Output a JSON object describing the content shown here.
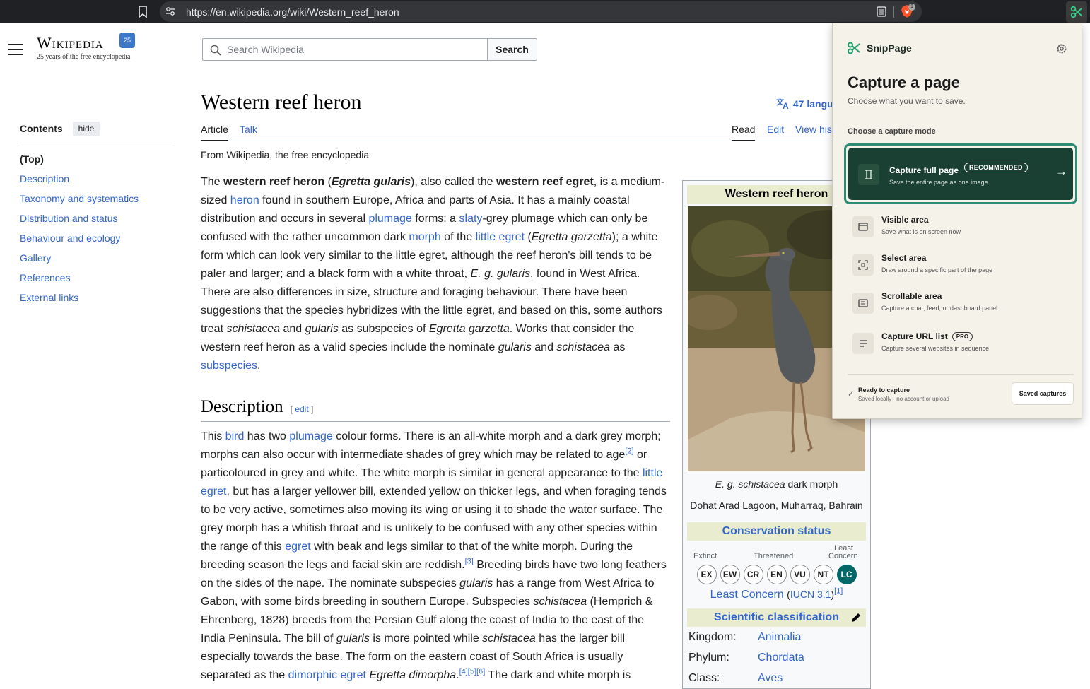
{
  "browser": {
    "url": "https://en.wikipedia.org/wiki/Western_reef_heron",
    "brave_badge": "1"
  },
  "wiki": {
    "logo_title": "Wikipedia",
    "logo_badge": "25",
    "tagline": "25 years of the free encyclopedia",
    "search_placeholder": "Search Wikipedia",
    "search_button": "Search",
    "page_title": "Western reef heron",
    "languages": "47 langu",
    "tabs": {
      "article": "Article",
      "talk": "Talk",
      "read": "Read",
      "edit": "Edit",
      "history": "View his"
    },
    "from": "From Wikipedia, the free encyclopedia",
    "toc": {
      "title": "Contents",
      "hide": "hide",
      "items": [
        "(Top)",
        "Description",
        "Taxonomy and systematics",
        "Distribution and status",
        "Behaviour and ecology",
        "Gallery",
        "References",
        "External links"
      ]
    },
    "lead": [
      {
        "t": "The "
      },
      {
        "t": "western reef heron",
        "b": true
      },
      {
        "t": " ("
      },
      {
        "t": "Egretta gularis",
        "b": true,
        "i": true
      },
      {
        "t": "), also called the "
      },
      {
        "t": "western reef egret",
        "b": true
      },
      {
        "t": ", is a medium-sized "
      },
      {
        "t": "heron",
        "a": true
      },
      {
        "t": " found in southern Europe, Africa and parts of Asia. It has a mainly coastal distribution and occurs in several "
      },
      {
        "t": "plumage",
        "a": true
      },
      {
        "t": " forms: a "
      },
      {
        "t": "slaty",
        "a": true
      },
      {
        "t": "-grey plumage which can only be confused with the rather uncommon dark "
      },
      {
        "t": "morph",
        "a": true
      },
      {
        "t": " of the "
      },
      {
        "t": "little egret",
        "a": true
      },
      {
        "t": " ("
      },
      {
        "t": "Egretta garzetta",
        "i": true
      },
      {
        "t": "); a white form which can look very similar to the little egret, although the reef heron's bill tends to be paler and larger; and a black form with a white throat, "
      },
      {
        "t": "E. g. gularis",
        "i": true
      },
      {
        "t": ", found in West Africa. There are also differences in size, structure and foraging behaviour. There have been suggestions that the species hybridizes with the little egret, and based on this, some authors treat "
      },
      {
        "t": "schistacea",
        "i": true
      },
      {
        "t": " and "
      },
      {
        "t": "gularis",
        "i": true
      },
      {
        "t": " as subspecies of "
      },
      {
        "t": "Egretta garzetta",
        "i": true
      },
      {
        "t": ". Works that consider the western reef heron as a valid species include the nominate "
      },
      {
        "t": "gularis",
        "i": true
      },
      {
        "t": " and "
      },
      {
        "t": "schistacea",
        "i": true
      },
      {
        "t": " as "
      },
      {
        "t": "subspecies",
        "a": true
      },
      {
        "t": "."
      }
    ],
    "desc_heading": "Description",
    "desc_edit": "edit",
    "desc_para": [
      {
        "t": "This "
      },
      {
        "t": "bird",
        "a": true
      },
      {
        "t": " has two "
      },
      {
        "t": "plumage",
        "a": true
      },
      {
        "t": " colour forms. There is an all-white morph and a dark grey morph; morphs can also occur with intermediate shades of grey which may be related to age"
      },
      {
        "t": "[2]",
        "sup": true
      },
      {
        "t": " or particoloured in grey and white. The white morph is similar in general appearance to the "
      },
      {
        "t": "little egret",
        "a": true
      },
      {
        "t": ", but has a larger yellower bill, extended yellow on thicker legs, and when foraging tends to be very active, sometimes also moving its wing or using it to shade the water surface. The grey morph has a whitish throat and is unlikely to be confused with any other species within the range of this "
      },
      {
        "t": "egret",
        "a": true
      },
      {
        "t": " with beak and legs similar to that of the white morph. During the breeding season the legs and facial skin are reddish."
      },
      {
        "t": "[3]",
        "sup": true
      },
      {
        "t": " Breeding birds have two long feathers on the sides of the nape. The nominate subspecies "
      },
      {
        "t": "gularis",
        "i": true
      },
      {
        "t": " has a range from West Africa to Gabon, with some birds breeding in southern Europe. Subspecies "
      },
      {
        "t": "schistacea",
        "i": true
      },
      {
        "t": " (Hemprich & Ehrenberg, 1828) breeds from the Persian Gulf along the coast of India to the east of the India Peninsula. The bill of "
      },
      {
        "t": "gularis",
        "i": true
      },
      {
        "t": " is more pointed while "
      },
      {
        "t": "schistacea",
        "i": true
      },
      {
        "t": " has the larger bill especially towards the base. The form on the eastern coast of South Africa is usually separated as the "
      },
      {
        "t": "dimorphic egret",
        "a": true
      },
      {
        "t": " "
      },
      {
        "t": "Egretta dimorpha",
        "i": true
      },
      {
        "t": "."
      },
      {
        "t": "[4][5][6]",
        "sup": true
      },
      {
        "t": " The dark and white morph is"
      }
    ],
    "infobox": {
      "title": "Western reef heron",
      "caption1_italic": "E. g. schistacea",
      "caption1_rest": " dark morph",
      "caption2": "Dohat Arad Lagoon, Muharraq, Bahrain",
      "cons_heading": "Conservation status",
      "cons_labels": {
        "extinct": "Extinct",
        "threatened": "Threatened",
        "least1": "Least",
        "least2": "Concern"
      },
      "cons_codes": [
        "EX",
        "EW",
        "CR",
        "EN",
        "VU",
        "NT",
        "LC"
      ],
      "lc_text": "Least Concern",
      "iucn": "IUCN 3.1",
      "iucn_ref": "[1]",
      "sci_heading": "Scientific classification",
      "taxonomy": [
        {
          "k": "Kingdom:",
          "v": "Animalia"
        },
        {
          "k": "Phylum:",
          "v": "Chordata"
        },
        {
          "k": "Class:",
          "v": "Aves"
        }
      ]
    }
  },
  "snippage": {
    "name": "SnipPage",
    "title": "Capture a page",
    "subtitle": "Choose what you want to save.",
    "mode_label": "Choose a capture mode",
    "full": {
      "title": "Capture full page",
      "badge": "RECOMMENDED",
      "desc": "Save the entire page as one image",
      "arrow": "→"
    },
    "options": [
      {
        "title": "Visible area",
        "desc": "Save what is on screen now"
      },
      {
        "title": "Select area",
        "desc": "Draw around a specific part of the page"
      },
      {
        "title": "Scrollable area",
        "desc": "Capture a chat, feed, or dashboard panel"
      },
      {
        "title": "Capture URL list",
        "desc": "Capture several websites in sequence",
        "badge": "PRO"
      }
    ],
    "ready": "Ready to capture",
    "local": "Saved locally · no account or upload",
    "check": "✓",
    "saved_button": "Saved captures"
  },
  "colors": {
    "link": "#3366cc",
    "snippage_green": "#1a3f33",
    "snippage_accent": "#2c8c74",
    "lc_badge": "#006666"
  }
}
